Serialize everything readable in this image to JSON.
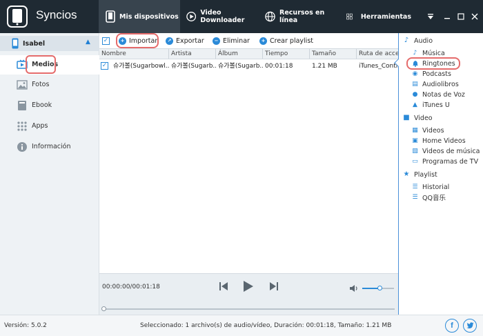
{
  "app": {
    "brand": "Syncios",
    "nav_tabs": [
      {
        "label": "Mis dispositivos",
        "icon": "phone-icon"
      },
      {
        "label": "Video Downloader",
        "icon": "play-circle-icon"
      },
      {
        "label": "Recursos en línea",
        "icon": "globe-icon"
      },
      {
        "label": "Herramientas",
        "icon": "grid-icon"
      }
    ]
  },
  "sidebar": {
    "device_name": "Isabel",
    "items": [
      {
        "label": "Medios",
        "icon": "tv-icon"
      },
      {
        "label": "Fotos",
        "icon": "photo-icon"
      },
      {
        "label": "Ebook",
        "icon": "book-icon"
      },
      {
        "label": "Apps",
        "icon": "apps-grid-icon"
      },
      {
        "label": "Información",
        "icon": "info-icon"
      }
    ]
  },
  "toolbar": {
    "import": "Importar",
    "export": "Exportar",
    "delete": "Eliminar",
    "create_playlist": "Crear playlist"
  },
  "table": {
    "columns": [
      "Nombre",
      "Artista",
      "Álbum",
      "Tiempo",
      "Tamaño",
      "Ruta de acce"
    ],
    "rows": [
      {
        "name": "슈가볼(Sugarbowl...",
        "artist": "슈가볼(Sugarb...",
        "album": "슈가볼(Sugarb...",
        "time": "00:01:18",
        "size": "1.21 MB",
        "path": "iTunes_Contr"
      }
    ]
  },
  "player": {
    "time": "00:00:00/00:01:18",
    "volume_level": 0.55,
    "progress": 0.0
  },
  "right_panel": {
    "sections": [
      {
        "title": "Audio",
        "items": [
          "Música",
          "Ringtones",
          "Podcasts",
          "Audiolibros",
          "Notas de Voz",
          "iTunes U"
        ]
      },
      {
        "title": "Video",
        "items": [
          "Videos",
          "Home Videos",
          "Videos de música",
          "Programas de TV"
        ]
      },
      {
        "title": "Playlist",
        "items": [
          "Historial",
          "QQ音乐"
        ]
      }
    ]
  },
  "status": {
    "version": "Versión: 5.0.2",
    "summary": "Seleccionado: 1 archivo(s) de audio/vídeo, Duración: 00:01:18, Tamaño: 1.21 MB"
  },
  "colors": {
    "header_bg": "#1f2a33",
    "accent": "#2a8ad8",
    "highlight": "#e56b6b"
  }
}
